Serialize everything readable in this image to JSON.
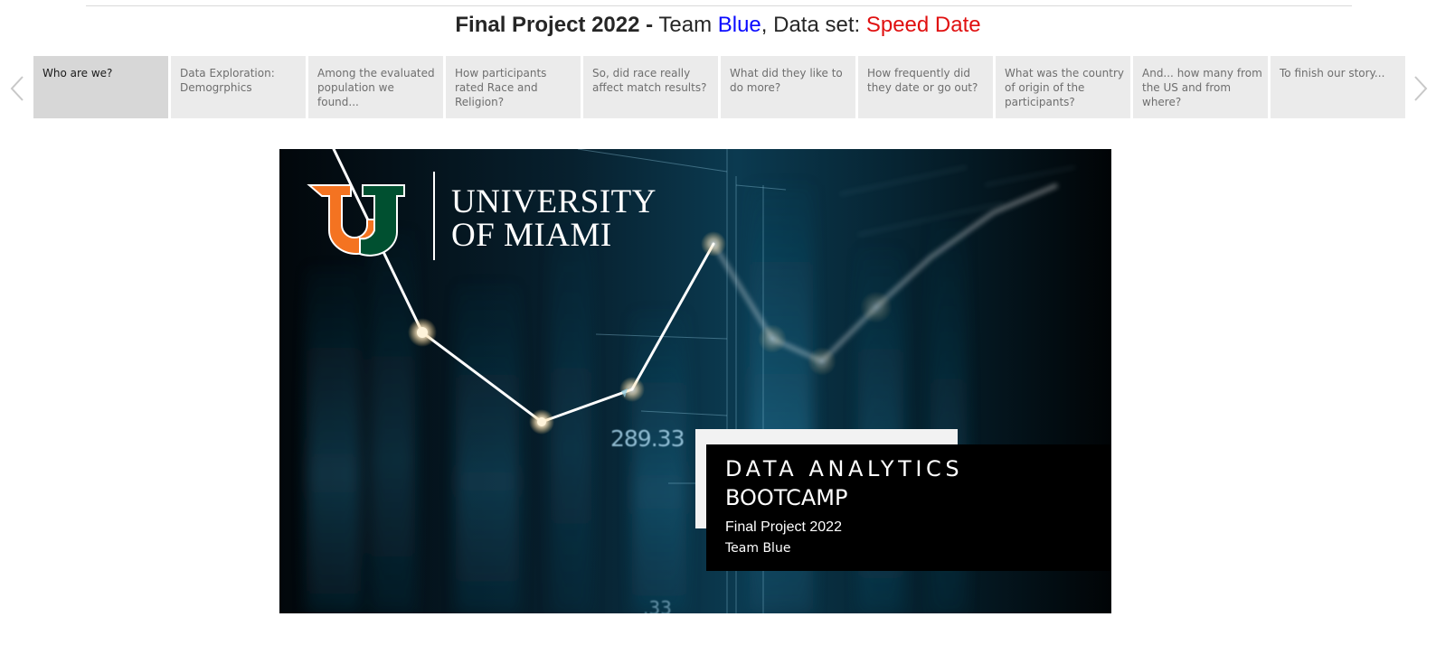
{
  "header": {
    "title_bold": "Final Project 2022 -",
    "title_team_prefix": "Team ",
    "title_team_name": "Blue",
    "title_dataset_prefix": ", Data set: ",
    "title_dataset_name": "Speed Date",
    "team_color": "#0a0aff",
    "dataset_color": "#e01010"
  },
  "story": {
    "active_index": 0,
    "points": [
      {
        "label": "Who are we?"
      },
      {
        "label": "Data Exploration: Demogrphics"
      },
      {
        "label": "Among the evaluated population we found..."
      },
      {
        "label": "How participants rated Race and Religion?"
      },
      {
        "label": "So, did race really affect match results?"
      },
      {
        "label": "What did they like to do more?"
      },
      {
        "label": "How frequently did they date or go out?"
      },
      {
        "label": "What was the country of origin of the participants?"
      },
      {
        "label": "And... how many from the US and from where?"
      },
      {
        "label": "To finish our story..."
      }
    ],
    "prev_icon": "chevron-left-icon",
    "next_icon": "chevron-right-icon"
  },
  "slide": {
    "logo_line1": "UNIVERSITY",
    "logo_line2": "OF MIAMI",
    "logo_icon": "university-of-miami-u-logo",
    "ticker_value": "289.33",
    "ticker_value_partial": ".33",
    "card_title_line1": "DATA ANALYTICS",
    "card_title_line2": "BOOTCAMP",
    "card_subtitle": "Final Project 2022",
    "card_team": "Team Blue",
    "logo_orange": "#f47321",
    "logo_green": "#005030"
  }
}
